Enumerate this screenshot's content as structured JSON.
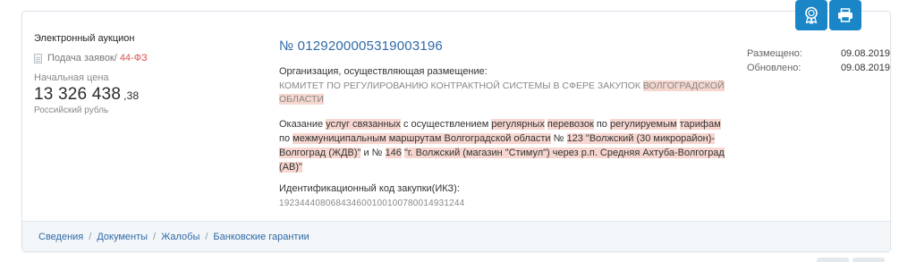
{
  "procurement": {
    "type": "Электронный аукцион",
    "status_label": "Подача заявок",
    "status_separator": " /",
    "law": "44-ФЗ",
    "price_label": "Начальная цена",
    "price_main": "13 326 438",
    "price_fraction": ",38",
    "currency": "Российский рубль",
    "reg_number": "№ 0129200005319003196",
    "org_label": "Организация, осуществляющая размещение:",
    "org_name_part1": "КОМИТЕТ ПО РЕГУЛИРОВАНИЮ КОНТРАКТНОЙ СИСТЕМЫ В СФЕРЕ ЗАКУПОК ",
    "org_name_hl1": "ВОЛГОГРАДСКОЙ",
    "org_name_sep": " ",
    "org_name_hl2": "ОБЛАСТИ",
    "subject": {
      "t1": "Оказание ",
      "h1": "услуг связанных",
      "t2": " с осуществлением ",
      "h2": "регулярных",
      "t3": " ",
      "h3": "перевозок",
      "t4": " по ",
      "h4": "регулируемым",
      "t5": " ",
      "h5": "тарифам",
      "t6": " по ",
      "h6": "межмуниципальным маршрутам Волгоградской области",
      "t7": " № ",
      "h7": "123 \"Волжский (30 микрорайон)-Волгоград (ЖДВ)\"",
      "t8": " и № ",
      "h8": "146",
      "t9": " ",
      "h9": "\"г. Волжский (магазин \"Стимул\") через р.п. Средняя Ахтуба-Волгоград (АВ)\""
    },
    "ikz_label": "Идентификационный код закупки(ИКЗ):",
    "ikz_value": "192344408068434600100100780014931244",
    "dates": {
      "placed_label": "Размещено:",
      "placed_value": "09.08.2019",
      "updated_label": "Обновлено:",
      "updated_value": "09.08.2019"
    }
  },
  "footer_links": {
    "info": "Сведения",
    "docs": "Документы",
    "complaints": "Жалобы",
    "guarantees": "Банковские гарантии",
    "separator": "/"
  },
  "icons": {
    "award": "award-icon",
    "print": "printer-icon",
    "document": "document-icon"
  },
  "colors": {
    "accent": "#1a86c7",
    "link": "#2f6aa8",
    "law": "#d9534f",
    "highlight": "#f6d6cf"
  }
}
